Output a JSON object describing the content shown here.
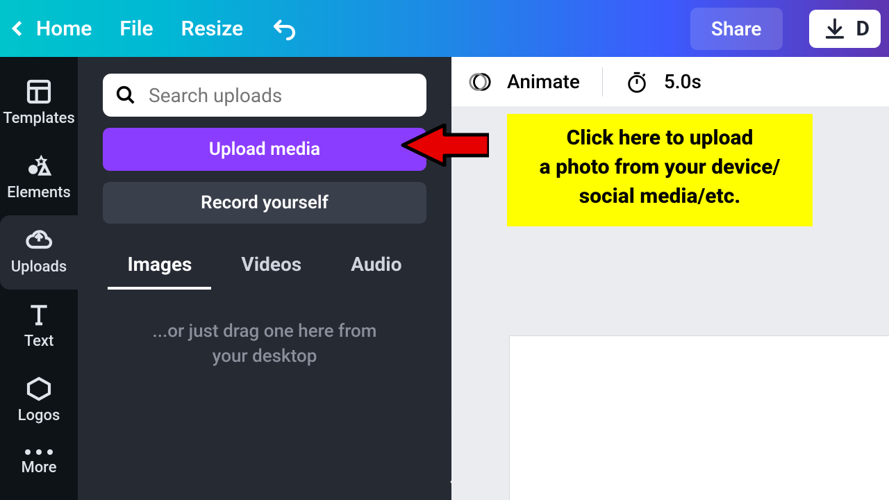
{
  "topbar": {
    "home": "Home",
    "file": "File",
    "resize": "Resize",
    "share": "Share",
    "download_letter": "D"
  },
  "rail": {
    "templates": "Templates",
    "elements": "Elements",
    "uploads": "Uploads",
    "text": "Text",
    "logos": "Logos",
    "more": "More"
  },
  "panel": {
    "search_placeholder": "Search uploads",
    "upload_btn": "Upload media",
    "record_btn": "Record yourself",
    "tabs": {
      "images": "Images",
      "videos": "Videos",
      "audio": "Audio"
    },
    "drag_hint_l1": "...or just drag one here from",
    "drag_hint_l2": "your desktop",
    "collapse_glyph": "‹"
  },
  "canvasbar": {
    "animate": "Animate",
    "duration": "5.0s"
  },
  "callout": {
    "l1": "Click here to upload",
    "l2": "a photo from your device/",
    "l3": "social media/etc."
  },
  "colors": {
    "accent_purple": "#8b3dff",
    "panel_bg": "#252a33",
    "rail_bg": "#0e1318",
    "callout_bg": "#ffff00",
    "arrow_fill": "#e60000"
  }
}
